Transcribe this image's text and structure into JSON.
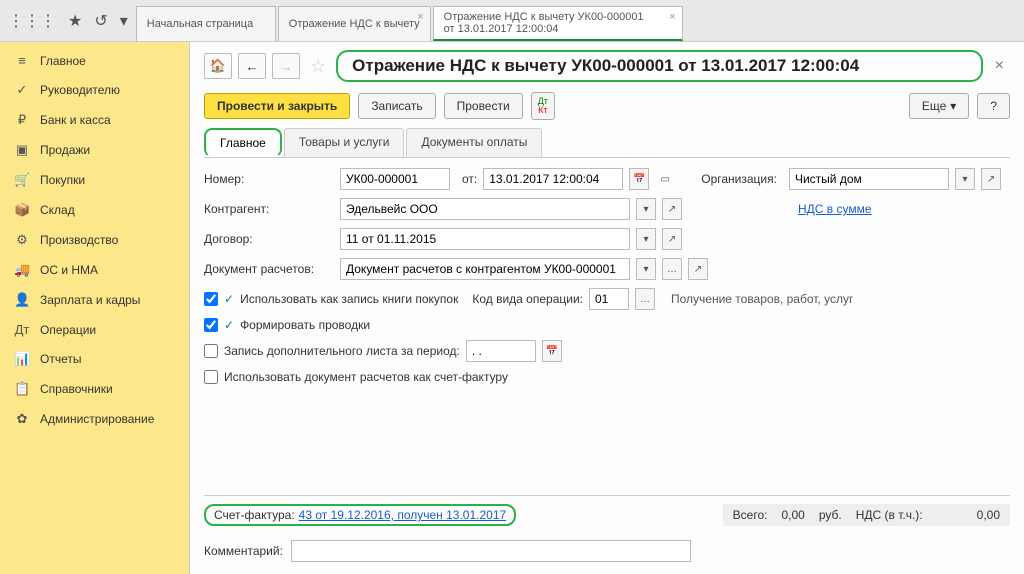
{
  "topbar": {
    "tabs": [
      {
        "l1": "Начальная страница"
      },
      {
        "l1": "Отражение НДС к вычету"
      },
      {
        "l1": "Отражение НДС к вычету УК00-000001",
        "l2": "от 13.01.2017 12:00:04"
      }
    ]
  },
  "sidebar": {
    "items": [
      {
        "icon": "≡",
        "label": "Главное"
      },
      {
        "icon": "✓",
        "label": "Руководителю"
      },
      {
        "icon": "₽",
        "label": "Банк и касса"
      },
      {
        "icon": "▣",
        "label": "Продажи"
      },
      {
        "icon": "🛒",
        "label": "Покупки"
      },
      {
        "icon": "📦",
        "label": "Склад"
      },
      {
        "icon": "⚙",
        "label": "Производство"
      },
      {
        "icon": "🚚",
        "label": "ОС и НМА"
      },
      {
        "icon": "👤",
        "label": "Зарплата и кадры"
      },
      {
        "icon": "Дт",
        "label": "Операции"
      },
      {
        "icon": "📊",
        "label": "Отчеты"
      },
      {
        "icon": "📋",
        "label": "Справочники"
      },
      {
        "icon": "✿",
        "label": "Администрирование"
      }
    ]
  },
  "title": "Отражение НДС к вычету УК00-000001 от 13.01.2017 12:00:04",
  "toolbar": {
    "post_close": "Провести и закрыть",
    "write": "Записать",
    "post": "Провести",
    "more": "Еще",
    "help": "?"
  },
  "subtabs": {
    "main": "Главное",
    "goods": "Товары и услуги",
    "paydocs": "Документы оплаты"
  },
  "form": {
    "number_lbl": "Номер:",
    "number": "УК00-000001",
    "date_lbl": "от:",
    "date": "13.01.2017 12:00:04",
    "org_lbl": "Организация:",
    "org": "Чистый дом",
    "contragent_lbl": "Контрагент:",
    "contragent": "Эдельвейс ООО",
    "vat_link": "НДС в сумме",
    "contract_lbl": "Договор:",
    "contract": "11 от 01.11.2015",
    "calcdoc_lbl": "Документ расчетов:",
    "calcdoc": "Документ расчетов с контрагентом УК00-000001",
    "cb1": "Использовать как запись книги покупок",
    "opcode_lbl": "Код вида операции:",
    "opcode": "01",
    "opcode_desc": "Получение товаров, работ, услуг",
    "cb2": "Формировать проводки",
    "cb3": "Запись дополнительного листа за период:",
    "period": ". .",
    "cb4": "Использовать документ расчетов как счет-фактуру"
  },
  "footer": {
    "sf_lbl": "Счет-фактура:",
    "sf_link": "43 от 19.12.2016, получен 13.01.2017",
    "total_lbl": "Всего:",
    "total": "0,00",
    "cur": "руб.",
    "vat_lbl": "НДС (в т.ч.):",
    "vat": "0,00",
    "comment_lbl": "Комментарий:"
  }
}
